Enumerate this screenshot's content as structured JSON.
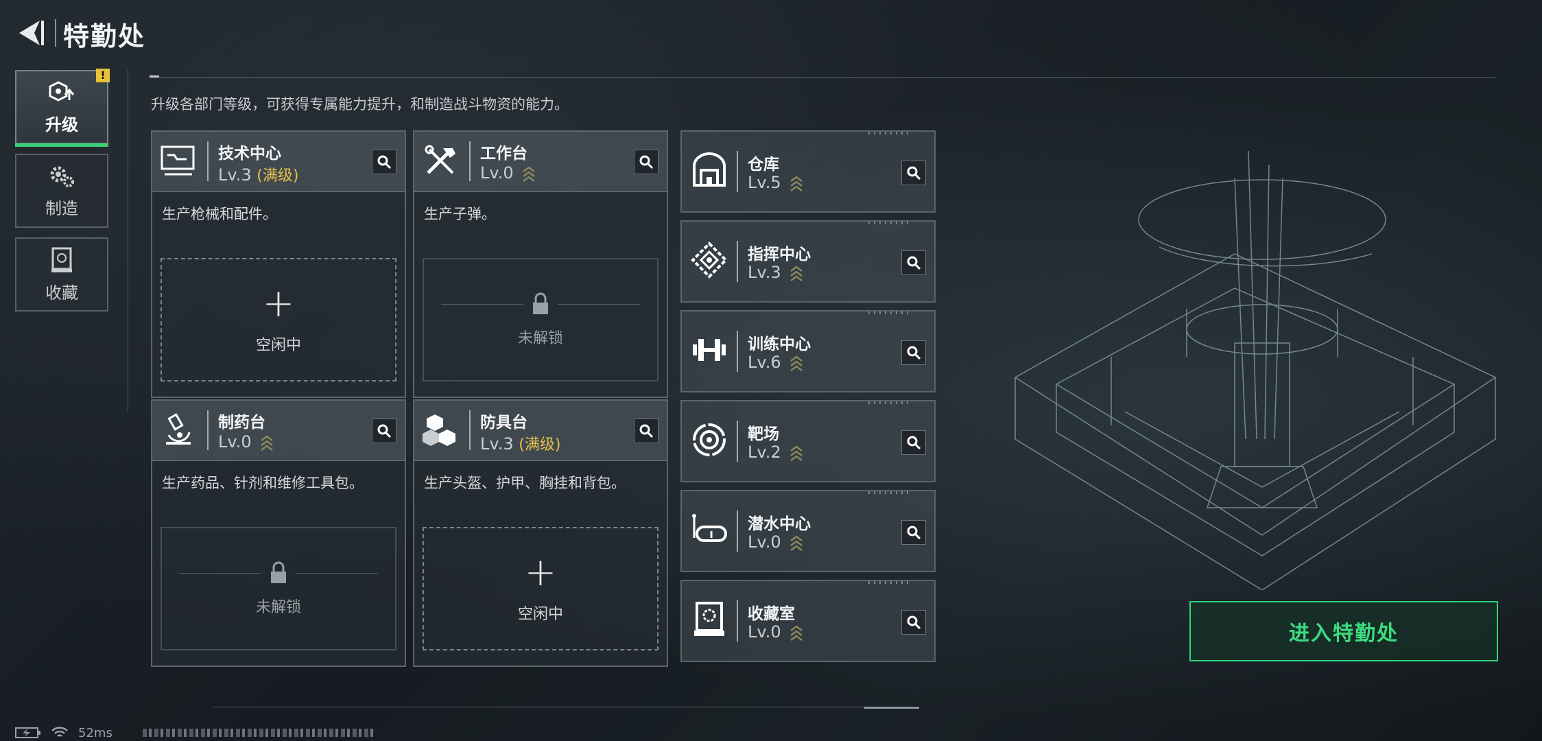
{
  "header": {
    "title": "特勤处"
  },
  "tabs": [
    {
      "label": "升级",
      "active": true,
      "alert": "!"
    },
    {
      "label": "制造",
      "active": false
    },
    {
      "label": "收藏",
      "active": false
    }
  ],
  "description": "升级各部门等级，可获得专属能力提升，和制造战斗物资的能力。",
  "departments": [
    {
      "name": "技术中心",
      "level": "Lv.3",
      "max_label": "(满级)",
      "desc": "生产枪械和配件。",
      "slot": "空闲中",
      "slot_state": "idle"
    },
    {
      "name": "工作台",
      "level": "Lv.0",
      "max_label": "",
      "desc": "生产子弹。",
      "slot": "未解锁",
      "slot_state": "locked"
    },
    {
      "name": "制药台",
      "level": "Lv.0",
      "max_label": "",
      "desc": "生产药品、针剂和维修工具包。",
      "slot": "未解锁",
      "slot_state": "locked"
    },
    {
      "name": "防具台",
      "level": "Lv.3",
      "max_label": "(满级)",
      "desc": "生产头盔、护甲、胸挂和背包。",
      "slot": "空闲中",
      "slot_state": "idle"
    }
  ],
  "facilities": [
    {
      "name": "仓库",
      "level": "Lv.5"
    },
    {
      "name": "指挥中心",
      "level": "Lv.3"
    },
    {
      "name": "训练中心",
      "level": "Lv.6"
    },
    {
      "name": "靶场",
      "level": "Lv.2"
    },
    {
      "name": "潜水中心",
      "level": "Lv.0"
    },
    {
      "name": "收藏室",
      "level": "Lv.0"
    }
  ],
  "enter_button": "进入特勤处",
  "status_bar": {
    "ping": "52ms"
  },
  "colors": {
    "accent_green": "#3ddc7f",
    "max_gold": "#e7c14a",
    "alert_yellow": "#e8c33a"
  }
}
